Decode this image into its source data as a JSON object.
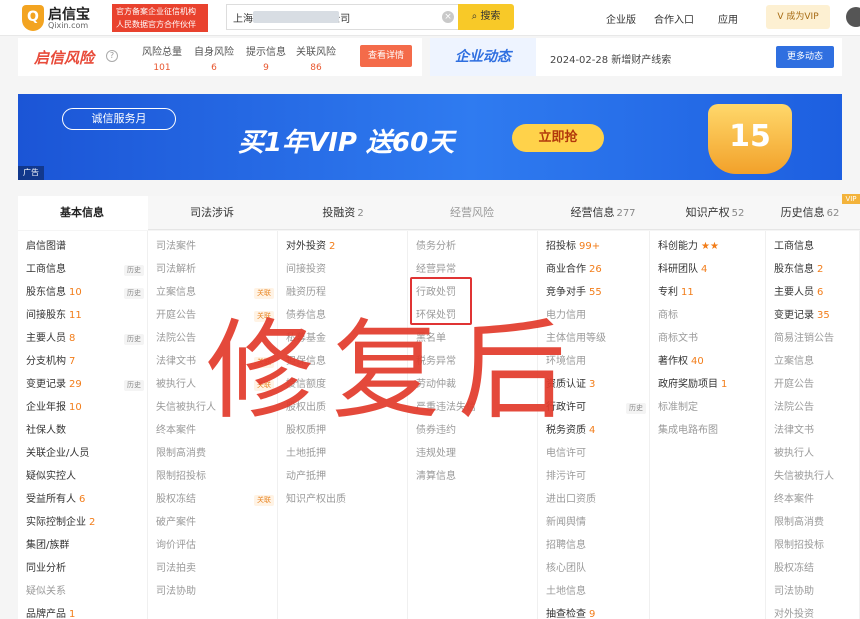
{
  "header": {
    "brand": "启信宝",
    "domain": "Qixin.com",
    "badge_line1": "官方备案企业征信机构",
    "badge_line2": "人民数据官方合作伙伴",
    "search_value": "上海                  有限公司",
    "search_button": "搜索",
    "nav": [
      "企业版",
      "合作入口",
      "应用"
    ],
    "vip_button": "成为VIP"
  },
  "risk": {
    "title": "启信风险",
    "stats": [
      {
        "label": "风险总量",
        "value": "101"
      },
      {
        "label": "自身风险",
        "value": "6"
      },
      {
        "label": "提示信息",
        "value": "9"
      },
      {
        "label": "关联风险",
        "value": "86"
      }
    ],
    "detail_button": "查看详情"
  },
  "dynamics": {
    "title": "企业动态",
    "text": "2024-02-28 新增财产线索",
    "more_button": "更多动态"
  },
  "banner": {
    "month_label": "诚信服务月",
    "headline": "买1年VIP 送60天",
    "cta": "立即抢",
    "deco": "15",
    "ad_tag": "广告"
  },
  "tabs": [
    {
      "label": "基本信息",
      "count": ""
    },
    {
      "label": "司法涉诉",
      "count": ""
    },
    {
      "label": "投融资",
      "count": "2"
    },
    {
      "label": "经营风险",
      "count": ""
    },
    {
      "label": "经营信息",
      "count": "277"
    },
    {
      "label": "知识产权",
      "count": "52"
    },
    {
      "label": "历史信息",
      "count": "62"
    }
  ],
  "vip_tag": "VIP",
  "columns": [
    [
      {
        "text": "启信图谱"
      },
      {
        "text": "工商信息",
        "tag": "历史"
      },
      {
        "text": "股东信息",
        "num": "10",
        "tag": "历史"
      },
      {
        "text": "间接股东",
        "num": "11"
      },
      {
        "text": "主要人员",
        "num": "8",
        "tag": "历史"
      },
      {
        "text": "分支机构",
        "num": "7"
      },
      {
        "text": "变更记录",
        "num": "29",
        "tag": "历史"
      },
      {
        "text": "企业年报",
        "num": "10"
      },
      {
        "text": "社保人数"
      },
      {
        "text": "关联企业/人员"
      },
      {
        "text": "疑似实控人"
      },
      {
        "text": "受益所有人",
        "num": "6"
      },
      {
        "text": "实际控制企业",
        "num": "2"
      },
      {
        "text": "集团/族群"
      },
      {
        "text": "同业分析"
      },
      {
        "text": "疑似关系",
        "dim": true
      },
      {
        "text": "品牌产品",
        "num": "1"
      }
    ],
    [
      {
        "text": "司法案件",
        "dim": true
      },
      {
        "text": "司法解析",
        "dim": true
      },
      {
        "text": "立案信息",
        "dim": true,
        "tag": "关联"
      },
      {
        "text": "开庭公告",
        "dim": true,
        "tag": "关联"
      },
      {
        "text": "法院公告",
        "dim": true
      },
      {
        "text": "法律文书",
        "dim": true,
        "tag": "关联"
      },
      {
        "text": "被执行人",
        "dim": true,
        "tag": "关联"
      },
      {
        "text": "失信被执行人",
        "dim": true
      },
      {
        "text": "终本案件",
        "dim": true
      },
      {
        "text": "限制高消费",
        "dim": true
      },
      {
        "text": "限制招投标",
        "dim": true
      },
      {
        "text": "股权冻结",
        "dim": true,
        "tag": "关联"
      },
      {
        "text": "破产案件",
        "dim": true
      },
      {
        "text": "询价评估",
        "dim": true
      },
      {
        "text": "司法拍卖",
        "dim": true
      },
      {
        "text": "司法协助",
        "dim": true
      }
    ],
    [
      {
        "text": "对外投资",
        "num": "2"
      },
      {
        "text": "间接投资",
        "dim": true
      },
      {
        "text": "融资历程",
        "dim": true
      },
      {
        "text": "债券信息",
        "dim": true
      },
      {
        "text": "私募基金",
        "dim": true
      },
      {
        "text": "担保信息",
        "dim": true
      },
      {
        "text": "授信额度",
        "dim": true
      },
      {
        "text": "股权出质",
        "dim": true
      },
      {
        "text": "股权质押",
        "dim": true
      },
      {
        "text": "土地抵押",
        "dim": true
      },
      {
        "text": "动产抵押",
        "dim": true
      },
      {
        "text": "知识产权出质",
        "dim": true
      }
    ],
    [
      {
        "text": "债务分析",
        "dim": true
      },
      {
        "text": "经营异常",
        "dim": true
      },
      {
        "text": "行政处罚",
        "dim": true
      },
      {
        "text": "环保处罚",
        "dim": true
      },
      {
        "text": "黑名单",
        "dim": true
      },
      {
        "text": "税务异常",
        "dim": true
      },
      {
        "text": "劳动仲裁",
        "dim": true
      },
      {
        "text": "严重违法失信",
        "dim": true
      },
      {
        "text": "债券违约",
        "dim": true
      },
      {
        "text": "违规处理",
        "dim": true
      },
      {
        "text": "清算信息",
        "dim": true
      }
    ],
    [
      {
        "text": "招投标",
        "num": "99+"
      },
      {
        "text": "商业合作",
        "num": "26"
      },
      {
        "text": "竞争对手",
        "num": "55"
      },
      {
        "text": "电力信用",
        "dim": true
      },
      {
        "text": "主体信用等级",
        "dim": true
      },
      {
        "text": "环境信用",
        "dim": true
      },
      {
        "text": "资质认证",
        "num": "3"
      },
      {
        "text": "行政许可",
        "num": "",
        "tag": "历史"
      },
      {
        "text": "税务资质",
        "num": "4"
      },
      {
        "text": "电信许可",
        "dim": true
      },
      {
        "text": "排污许可",
        "dim": true
      },
      {
        "text": "进出口资质",
        "dim": true
      },
      {
        "text": "新闻舆情",
        "dim": true
      },
      {
        "text": "招聘信息",
        "dim": true
      },
      {
        "text": "核心团队",
        "dim": true
      },
      {
        "text": "土地信息",
        "dim": true
      },
      {
        "text": "抽查检查",
        "num": "9"
      }
    ],
    [
      {
        "text": "科创能力",
        "num": "★★"
      },
      {
        "text": "科研团队",
        "num": "4"
      },
      {
        "text": "专利",
        "num": "11"
      },
      {
        "text": "商标",
        "dim": true
      },
      {
        "text": "商标文书",
        "dim": true
      },
      {
        "text": "著作权",
        "num": "40"
      },
      {
        "text": "政府奖励项目",
        "num": "1"
      },
      {
        "text": "标准制定",
        "dim": true
      },
      {
        "text": "集成电路布图",
        "dim": true
      }
    ],
    [
      {
        "text": "工商信息"
      },
      {
        "text": "股东信息",
        "num": "2"
      },
      {
        "text": "主要人员",
        "num": "6"
      },
      {
        "text": "变更记录",
        "num": "35"
      },
      {
        "text": "简易注销公告",
        "dim": true
      },
      {
        "text": "立案信息",
        "dim": true
      },
      {
        "text": "开庭公告",
        "dim": true
      },
      {
        "text": "法院公告",
        "dim": true
      },
      {
        "text": "法律文书",
        "dim": true
      },
      {
        "text": "被执行人",
        "dim": true
      },
      {
        "text": "失信被执行人",
        "dim": true
      },
      {
        "text": "终本案件",
        "dim": true
      },
      {
        "text": "限制高消费",
        "dim": true
      },
      {
        "text": "限制招投标",
        "dim": true
      },
      {
        "text": "股权冻结",
        "dim": true
      },
      {
        "text": "司法协助",
        "dim": true
      },
      {
        "text": "对外投资",
        "dim": true
      }
    ]
  ],
  "watermark": "修复后"
}
